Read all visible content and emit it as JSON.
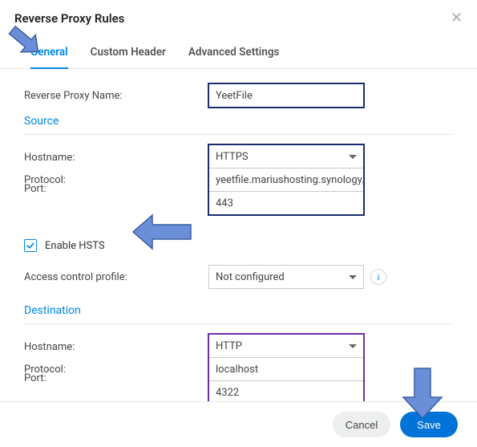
{
  "dialog": {
    "title": "Reverse Proxy Rules",
    "close_icon": "close"
  },
  "tabs": {
    "general": "General",
    "custom_header": "Custom Header",
    "advanced": "Advanced Settings"
  },
  "form": {
    "name_label": "Reverse Proxy Name:",
    "name_value": "YeetFile",
    "source_title": "Source",
    "protocol_label": "Protocol:",
    "source_protocol": "HTTPS",
    "hostname_label": "Hostname:",
    "source_hostname": "yeetfile.mariushosting.synology.me",
    "port_label": "Port:",
    "source_port": "443",
    "hsts_label": "Enable HSTS",
    "hsts_checked": true,
    "acp_label": "Access control profile:",
    "acp_value": "Not configured",
    "destination_title": "Destination",
    "dest_protocol": "HTTP",
    "dest_hostname": "localhost",
    "dest_port": "4322"
  },
  "buttons": {
    "cancel": "Cancel",
    "save": "Save"
  },
  "colors": {
    "accent": "#0086e5",
    "arrow": "#6a8fd8",
    "arrow_stroke": "#3b5fa0"
  }
}
